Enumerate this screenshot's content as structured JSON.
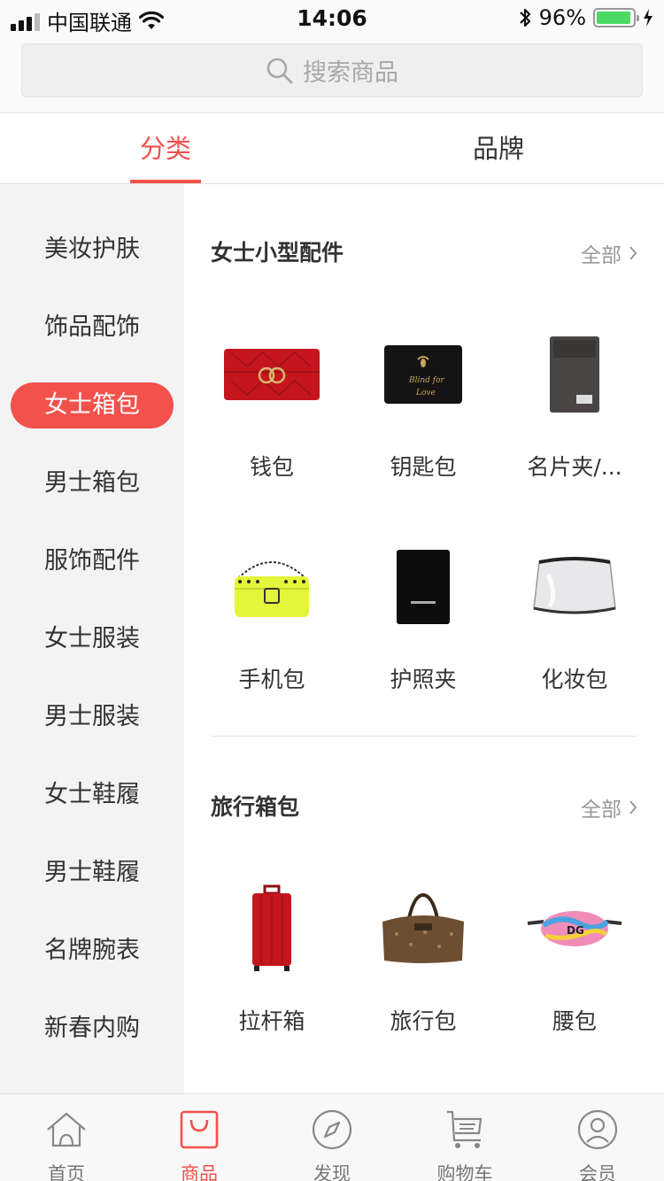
{
  "status_bar": {
    "carrier": "中国联通",
    "time": "14:06",
    "battery": "96%",
    "battery_level": 0.96
  },
  "search": {
    "placeholder": "搜索商品"
  },
  "tabs": [
    {
      "label": "分类",
      "active": true
    },
    {
      "label": "品牌",
      "active": false
    }
  ],
  "sidebar": {
    "items": [
      {
        "label": "美妆护肤"
      },
      {
        "label": "饰品配饰"
      },
      {
        "label": "女士箱包",
        "active": true
      },
      {
        "label": "男士箱包"
      },
      {
        "label": "服饰配件"
      },
      {
        "label": "女士服装"
      },
      {
        "label": "男士服装"
      },
      {
        "label": "女士鞋履"
      },
      {
        "label": "男士鞋履"
      },
      {
        "label": "名牌腕表"
      },
      {
        "label": "新春内购"
      }
    ]
  },
  "sections": [
    {
      "title": "女士小型配件",
      "all_label": "全部",
      "items": [
        {
          "label": "钱包",
          "icon": "red-wallet-image"
        },
        {
          "label": "钥匙包",
          "icon": "black-key-case-image"
        },
        {
          "label": "名片夹/...",
          "icon": "card-holder-image"
        },
        {
          "label": "手机包",
          "icon": "yellow-phone-bag-image"
        },
        {
          "label": "护照夹",
          "icon": "black-passport-holder-image"
        },
        {
          "label": "化妆包",
          "icon": "clear-cosmetic-bag-image"
        }
      ]
    },
    {
      "title": "旅行箱包",
      "all_label": "全部",
      "items": [
        {
          "label": "拉杆箱",
          "icon": "red-trolley-case-image"
        },
        {
          "label": "旅行包",
          "icon": "duffel-bag-image"
        },
        {
          "label": "腰包",
          "icon": "belt-bag-image"
        }
      ]
    }
  ],
  "tabbar": [
    {
      "label": "首页",
      "icon": "home-icon"
    },
    {
      "label": "商品",
      "icon": "shopping-bag-icon",
      "active": true
    },
    {
      "label": "发现",
      "icon": "compass-icon"
    },
    {
      "label": "购物车",
      "icon": "cart-icon"
    },
    {
      "label": "会员",
      "icon": "member-icon"
    }
  ],
  "colors": {
    "accent": "#f2514c",
    "sidebar_bg": "#f3f3f3",
    "battery": "#4cd964"
  }
}
